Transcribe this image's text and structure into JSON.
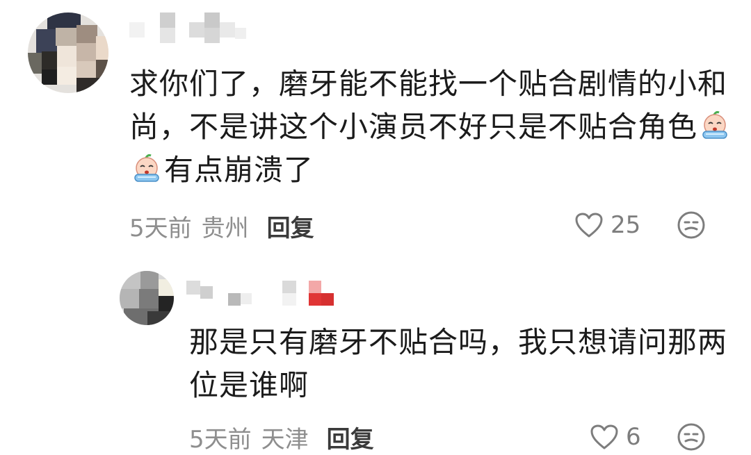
{
  "comments": [
    {
      "text_lines": [
        "求你们了，磨牙能不能找一个贴合剧情的小和",
        "尚，不是讲这个小演员不好只是不贴合角色",
        "有点崩溃了"
      ],
      "emoji": "crying-face-emoji",
      "time": "5天前",
      "location": "贵州",
      "reply_label": "回复",
      "likes": "25",
      "like_icon": "heart-outline-icon",
      "dislike_icon": "unhappy-face-icon"
    },
    {
      "text_lines": [
        "那是只有磨牙不贴合吗，我只想请问那两",
        "位是谁啊"
      ],
      "time": "5天前",
      "location": "天津",
      "reply_label": "回复",
      "likes": "6",
      "like_icon": "heart-outline-icon",
      "dislike_icon": "unhappy-face-icon"
    }
  ],
  "colors": {
    "text": "#1b1b1b",
    "meta": "#8e8e8e",
    "reply": "#3a3a3a",
    "icon": "#7d7d7d",
    "emoji_face": "#fbd7c4",
    "emoji_tears": "#8ec7f0"
  }
}
